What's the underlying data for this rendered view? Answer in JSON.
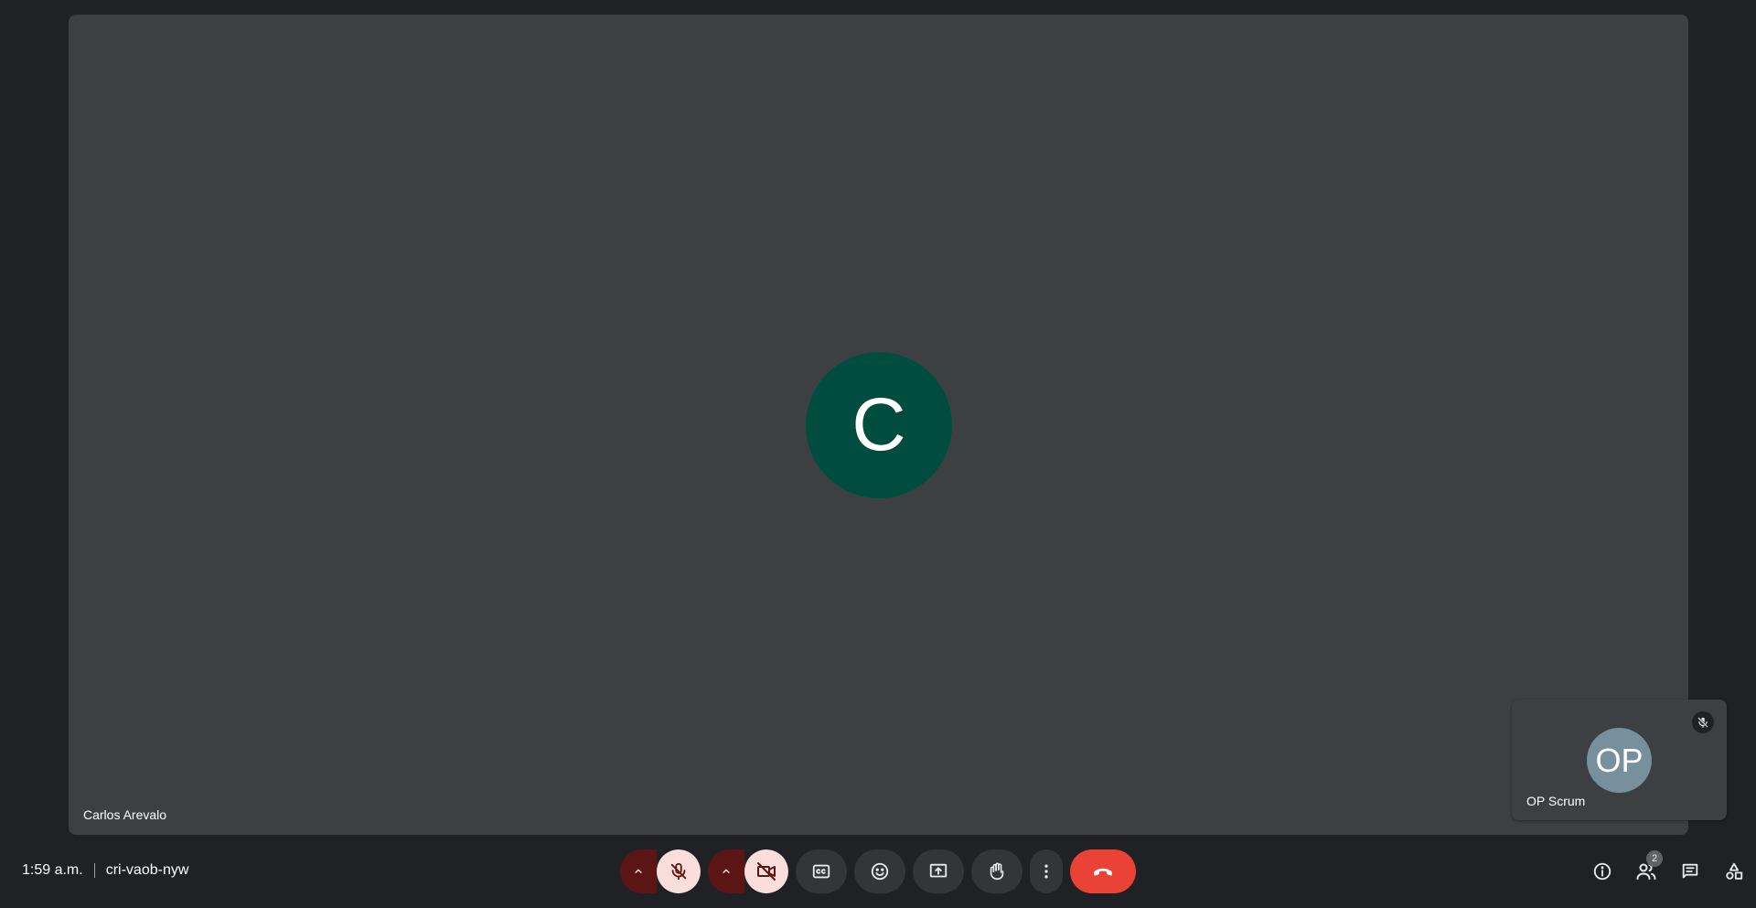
{
  "main_participant": {
    "initial": "C",
    "name": "Carlos Arevalo",
    "avatar_color": "#004d40"
  },
  "self_participant": {
    "initials": "OP",
    "name": "OP Scrum",
    "avatar_color": "#78909c",
    "muted": true
  },
  "meeting": {
    "time": "1:59 a.m.",
    "code": "cri-vaob-nyw"
  },
  "controls": {
    "mic": {
      "icon": "mic-off-icon",
      "state": "off"
    },
    "camera": {
      "icon": "videocam-off-icon",
      "state": "off"
    },
    "captions": {
      "icon": "closed-captions-icon"
    },
    "reactions": {
      "icon": "emoji-icon"
    },
    "present": {
      "icon": "present-screen-icon"
    },
    "raise_hand": {
      "icon": "raise-hand-icon"
    },
    "more": {
      "icon": "more-vert-icon"
    },
    "leave": {
      "icon": "call-end-icon",
      "color": "#ea4335"
    }
  },
  "side_panel": {
    "info": {
      "icon": "info-icon"
    },
    "people": {
      "icon": "people-icon",
      "count": "2"
    },
    "chat": {
      "icon": "chat-icon"
    },
    "activities": {
      "icon": "activities-icon"
    }
  }
}
